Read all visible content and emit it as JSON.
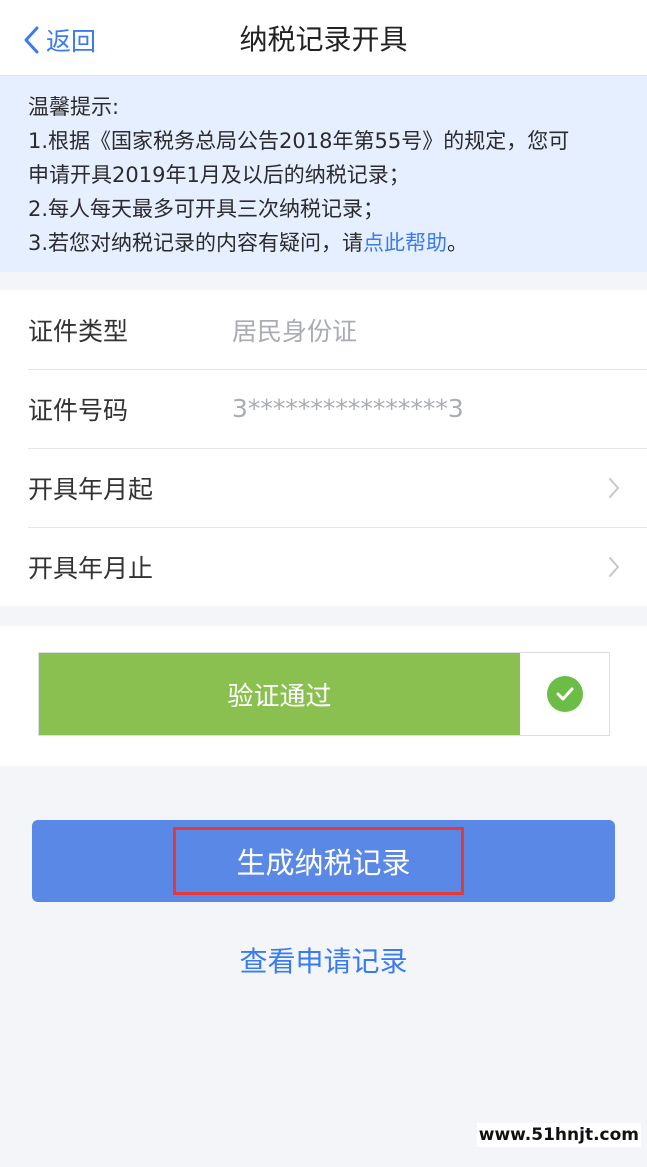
{
  "header": {
    "back_label": "返回",
    "title": "纳税记录开具"
  },
  "notice": {
    "heading": "温馨提示:",
    "line1": "1.根据《国家税务总局公告2018年第55号》的规定，您可",
    "line2": "申请开具2019年1月及以后的纳税记录；",
    "line3": "2.每人每天最多可开具三次纳税记录；",
    "line4_prefix": "3.若您对纳税记录的内容有疑问，请",
    "line4_link": "点此帮助",
    "line4_suffix": "。"
  },
  "form": {
    "rows": [
      {
        "label": "证件类型",
        "value": "居民身份证"
      },
      {
        "label": "证件号码",
        "value": "3****************3"
      },
      {
        "label": "开具年月起",
        "value": ""
      },
      {
        "label": "开具年月止",
        "value": ""
      }
    ]
  },
  "verify": {
    "label": "验证通过",
    "progress": 1.0
  },
  "actions": {
    "generate_label": "生成纳税记录",
    "view_records_label": "查看申请记录"
  },
  "watermark": "www.51hnjt.com",
  "colors": {
    "accent": "#3a7bf2",
    "primary_button": "#5a88e6",
    "verify_green": "#8ac04f",
    "check_green": "#6cbd45",
    "highlight_red": "#e53935",
    "notice_bg": "#e6efff"
  }
}
